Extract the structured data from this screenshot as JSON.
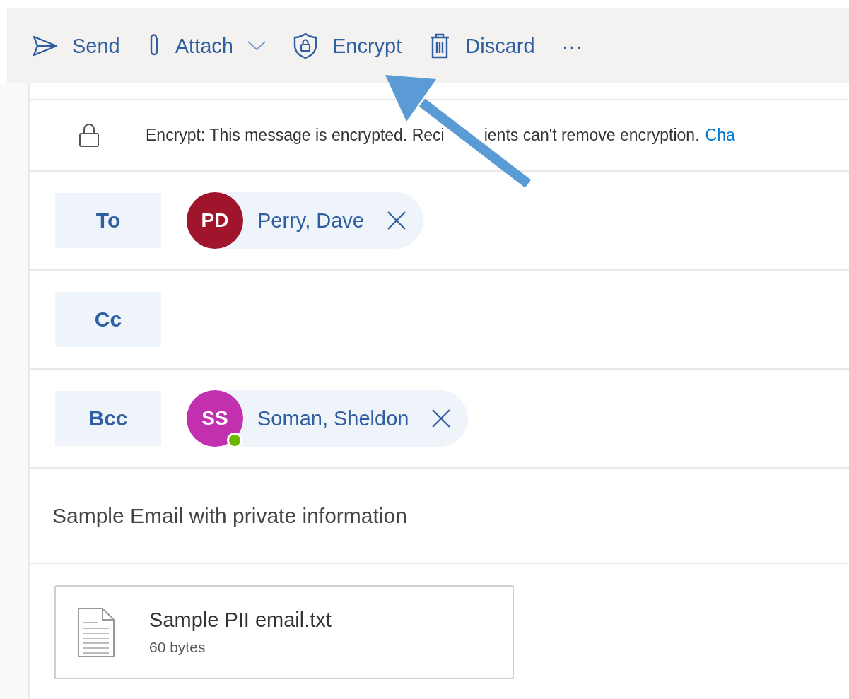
{
  "toolbar": [
    {
      "label": "Send",
      "has_dropdown": false
    },
    {
      "label": "Attach",
      "has_dropdown": true
    },
    {
      "label": "Encrypt",
      "has_dropdown": false
    },
    {
      "label": "Discard",
      "has_dropdown": false
    },
    {
      "label": "···",
      "has_dropdown": false
    }
  ],
  "encryption_notice": {
    "text_before_arrow": "Encrypt: This message is encrypted. Reci",
    "text_after_arrow": "ients can't remove encryption.",
    "link": "Cha"
  },
  "recipient_fields": [
    {
      "label": "To",
      "people": [
        {
          "initials": "PD",
          "name": "Perry, Dave",
          "color": "#a0152c",
          "online": false
        }
      ]
    },
    {
      "label": "Cc"
    },
    {
      "label": "Bcc",
      "people": [
        {
          "initials": "SS",
          "name": "Soman, Sheldon",
          "color": "#c230b0",
          "online": true
        }
      ]
    }
  ],
  "subject": "Sample Email with private information",
  "attachments": [
    {
      "name": "Sample PII email.txt",
      "size": "60 bytes"
    }
  ]
}
